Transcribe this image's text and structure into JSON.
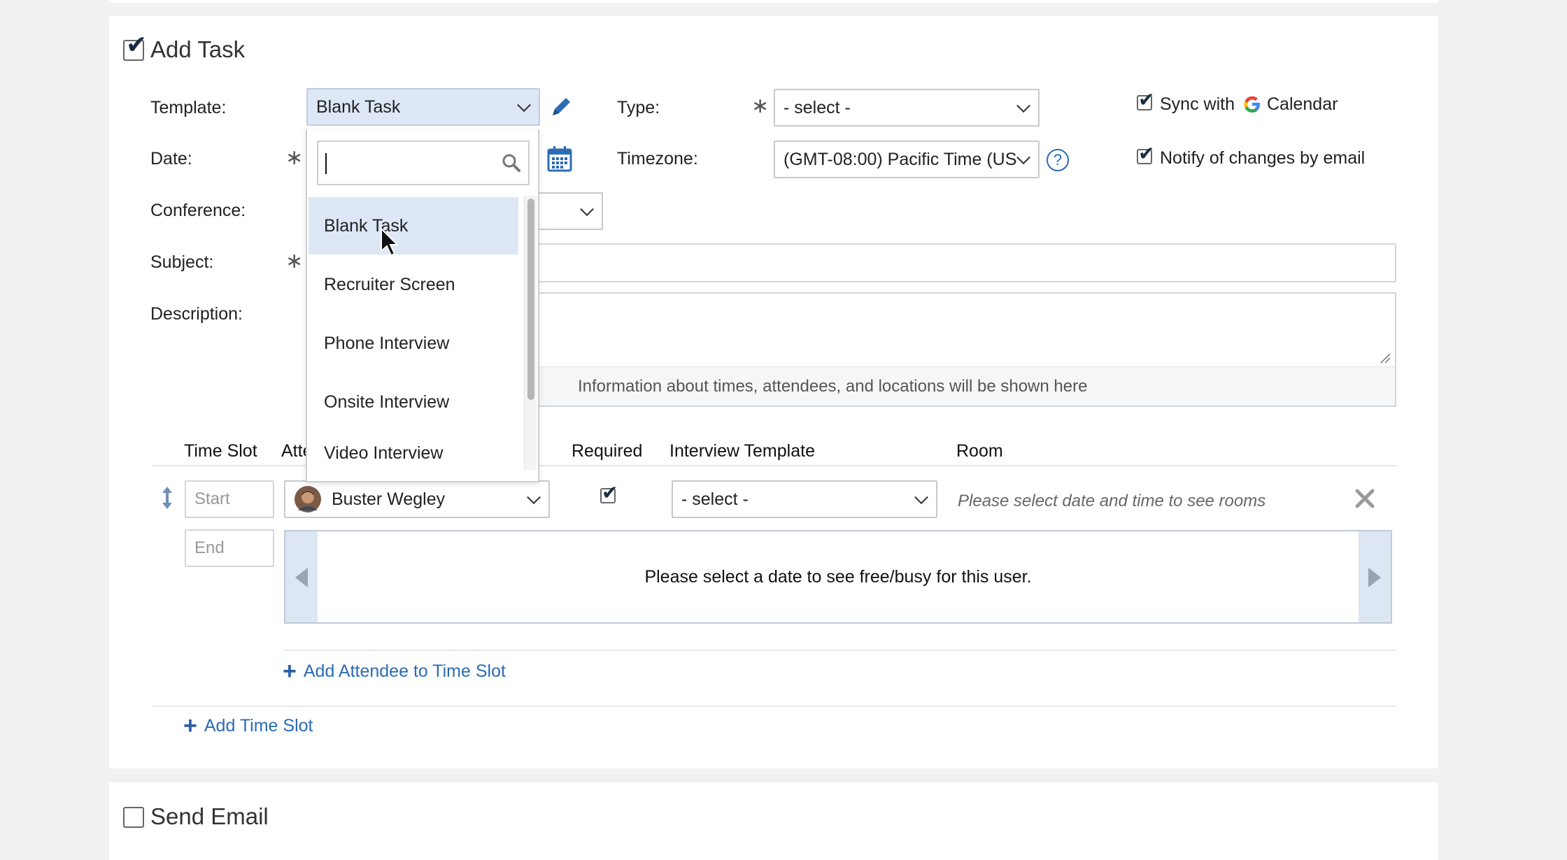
{
  "add_task": {
    "title": "Add Task",
    "checked": true,
    "template_label": "Template:",
    "template_value": "Blank Task",
    "type_label": "Type:",
    "type_value": "- select -",
    "sync_calendar_prefix": "Sync with",
    "sync_calendar_suffix": "Calendar",
    "notify_label": "Notify of changes by email",
    "date_label": "Date:",
    "timezone_label": "Timezone:",
    "timezone_value": "(GMT-08:00) Pacific Time (US",
    "conference_label": "Conference:",
    "subject_label": "Subject:",
    "description_label": "Description:",
    "description_info": "Information about times, attendees, and locations will be shown here"
  },
  "template_dropdown": {
    "search_value": "",
    "items": [
      "Blank Task",
      "Recruiter Screen",
      "Phone Interview",
      "Onsite Interview",
      "Video Interview"
    ],
    "highlighted_index": 0
  },
  "time_slot_table": {
    "headers": {
      "time_slot": "Time Slot",
      "attendee": "Atte",
      "required": "Required",
      "interview_template": "Interview Template",
      "room": "Room"
    },
    "row": {
      "start_placeholder": "Start",
      "end_placeholder": "End",
      "attendee": "Buster Wegley",
      "required": true,
      "interview_template": "- select -",
      "room_hint": "Please select date and time to see rooms",
      "freebusy_msg": "Please select a date to see free/busy for this user."
    },
    "add_attendee": "Add Attendee to Time Slot",
    "add_time_slot": "Add Time Slot"
  },
  "send_email": {
    "title": "Send Email",
    "checked": false
  },
  "colors": {
    "accent_blue": "#2b6cb3",
    "highlight": "#dde7f6"
  }
}
